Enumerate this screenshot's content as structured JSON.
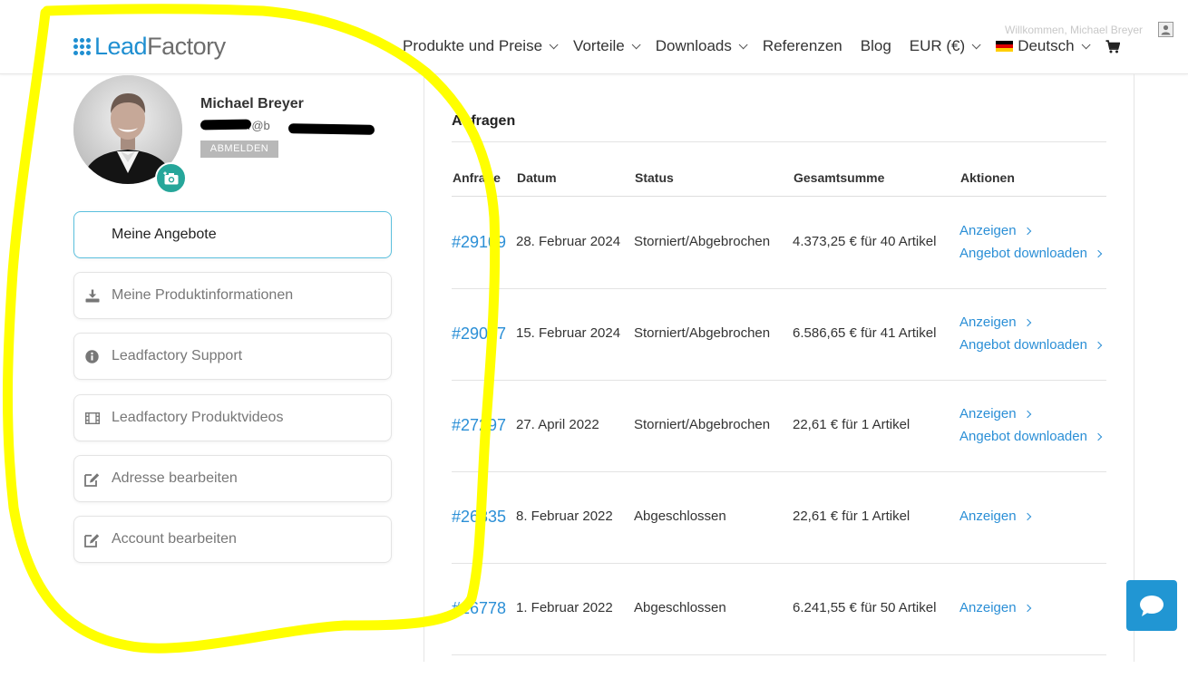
{
  "brand": {
    "logo_part1": "Lead",
    "logo_part2": "Factory",
    "accent": "#1f8fd1"
  },
  "header": {
    "welcome": "Willkommen, Michael Breyer",
    "nav": [
      {
        "label": "Produkte und Preise",
        "has_dropdown": true
      },
      {
        "label": "Vorteile",
        "has_dropdown": true
      },
      {
        "label": "Downloads",
        "has_dropdown": true
      },
      {
        "label": "Referenzen",
        "has_dropdown": false
      },
      {
        "label": "Blog",
        "has_dropdown": false
      },
      {
        "label": "EUR (€)",
        "has_dropdown": true
      },
      {
        "label": "Deutsch",
        "has_dropdown": true,
        "icon": "germany-flag-icon"
      }
    ],
    "cart_icon": "cart-icon"
  },
  "profile": {
    "name": "Michael Breyer",
    "email_visible": "r@b",
    "logout_label": "ABMELDEN",
    "camera_icon": "camera-plus-icon",
    "camera_color": "#26a69a"
  },
  "sidebar": {
    "items": [
      {
        "label": "Meine Angebote",
        "icon": "",
        "active": true
      },
      {
        "label": "Meine Produktinformationen",
        "icon": "download-icon",
        "active": false
      },
      {
        "label": "Leadfactory Support",
        "icon": "info-icon",
        "active": false
      },
      {
        "label": "Leadfactory Produktvideos",
        "icon": "film-icon",
        "active": false
      },
      {
        "label": "Adresse bearbeiten",
        "icon": "edit-icon",
        "active": false
      },
      {
        "label": "Account bearbeiten",
        "icon": "edit-icon",
        "active": false
      }
    ]
  },
  "main": {
    "title": "Anfragen",
    "columns": [
      "Anfrage",
      "Datum",
      "Status",
      "Gesamtsumme",
      "Aktionen"
    ],
    "rows": [
      {
        "id": "#29109",
        "date": "28. Februar 2024",
        "status": "Storniert/Abgebrochen",
        "total": "4.373,25 € für 40 Artikel",
        "actions": [
          "Anzeigen",
          "Angebot downloaden"
        ]
      },
      {
        "id": "#29047",
        "date": "15. Februar 2024",
        "status": "Storniert/Abgebrochen",
        "total": "6.586,65 € für 41 Artikel",
        "actions": [
          "Anzeigen",
          "Angebot downloaden"
        ]
      },
      {
        "id": "#27297",
        "date": "27. April 2022",
        "status": "Storniert/Abgebrochen",
        "total": "22,61 € für 1 Artikel",
        "actions": [
          "Anzeigen",
          "Angebot downloaden"
        ]
      },
      {
        "id": "#26835",
        "date": "8. Februar 2022",
        "status": "Abgeschlossen",
        "total": "22,61 € für 1 Artikel",
        "actions": [
          "Anzeigen"
        ]
      },
      {
        "id": "#26778",
        "date": "1. Februar 2022",
        "status": "Abgeschlossen",
        "total": "6.241,55 € für 50 Artikel",
        "actions": [
          "Anzeigen"
        ]
      }
    ],
    "link_color": "#2b8fd6"
  },
  "chat": {
    "icon": "chat-bubble-icon",
    "color": "#2196d3"
  },
  "annotation": {
    "color": "#ffff00"
  }
}
